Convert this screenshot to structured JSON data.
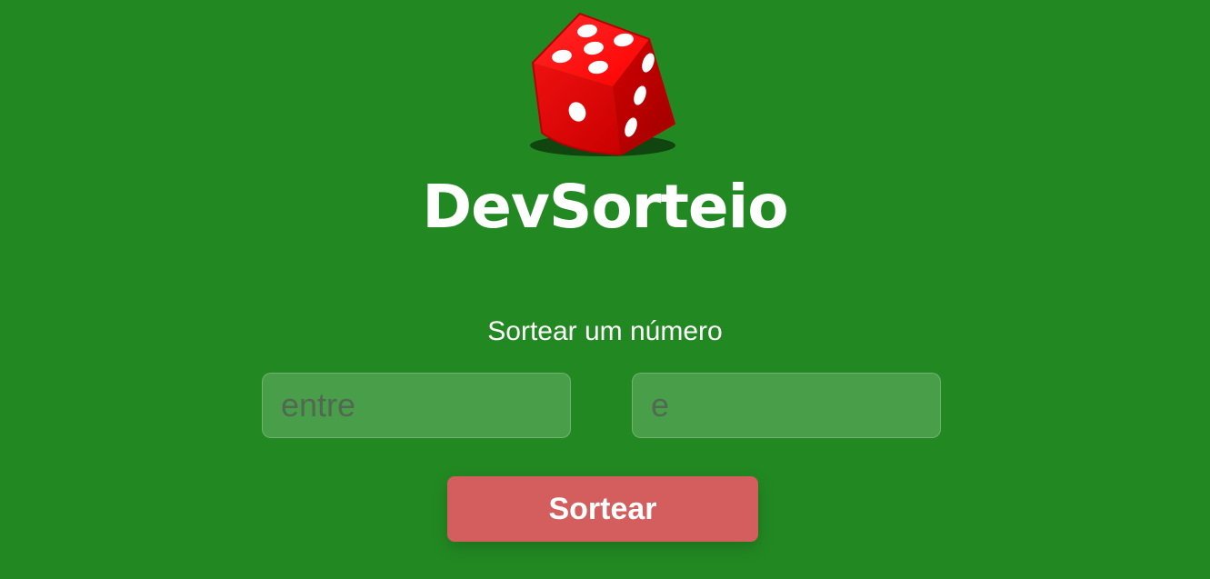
{
  "app": {
    "title": "DevSorteio",
    "logo_icon": "red-dice-icon"
  },
  "form": {
    "heading": "Sortear um número",
    "min_input": {
      "value": "",
      "placeholder": "entre"
    },
    "max_input": {
      "value": "",
      "placeholder": "e"
    },
    "submit_label": "Sortear"
  },
  "colors": {
    "background": "#228922",
    "button": "#d45e5e",
    "dice": "#e20000",
    "text": "#ffffff"
  }
}
